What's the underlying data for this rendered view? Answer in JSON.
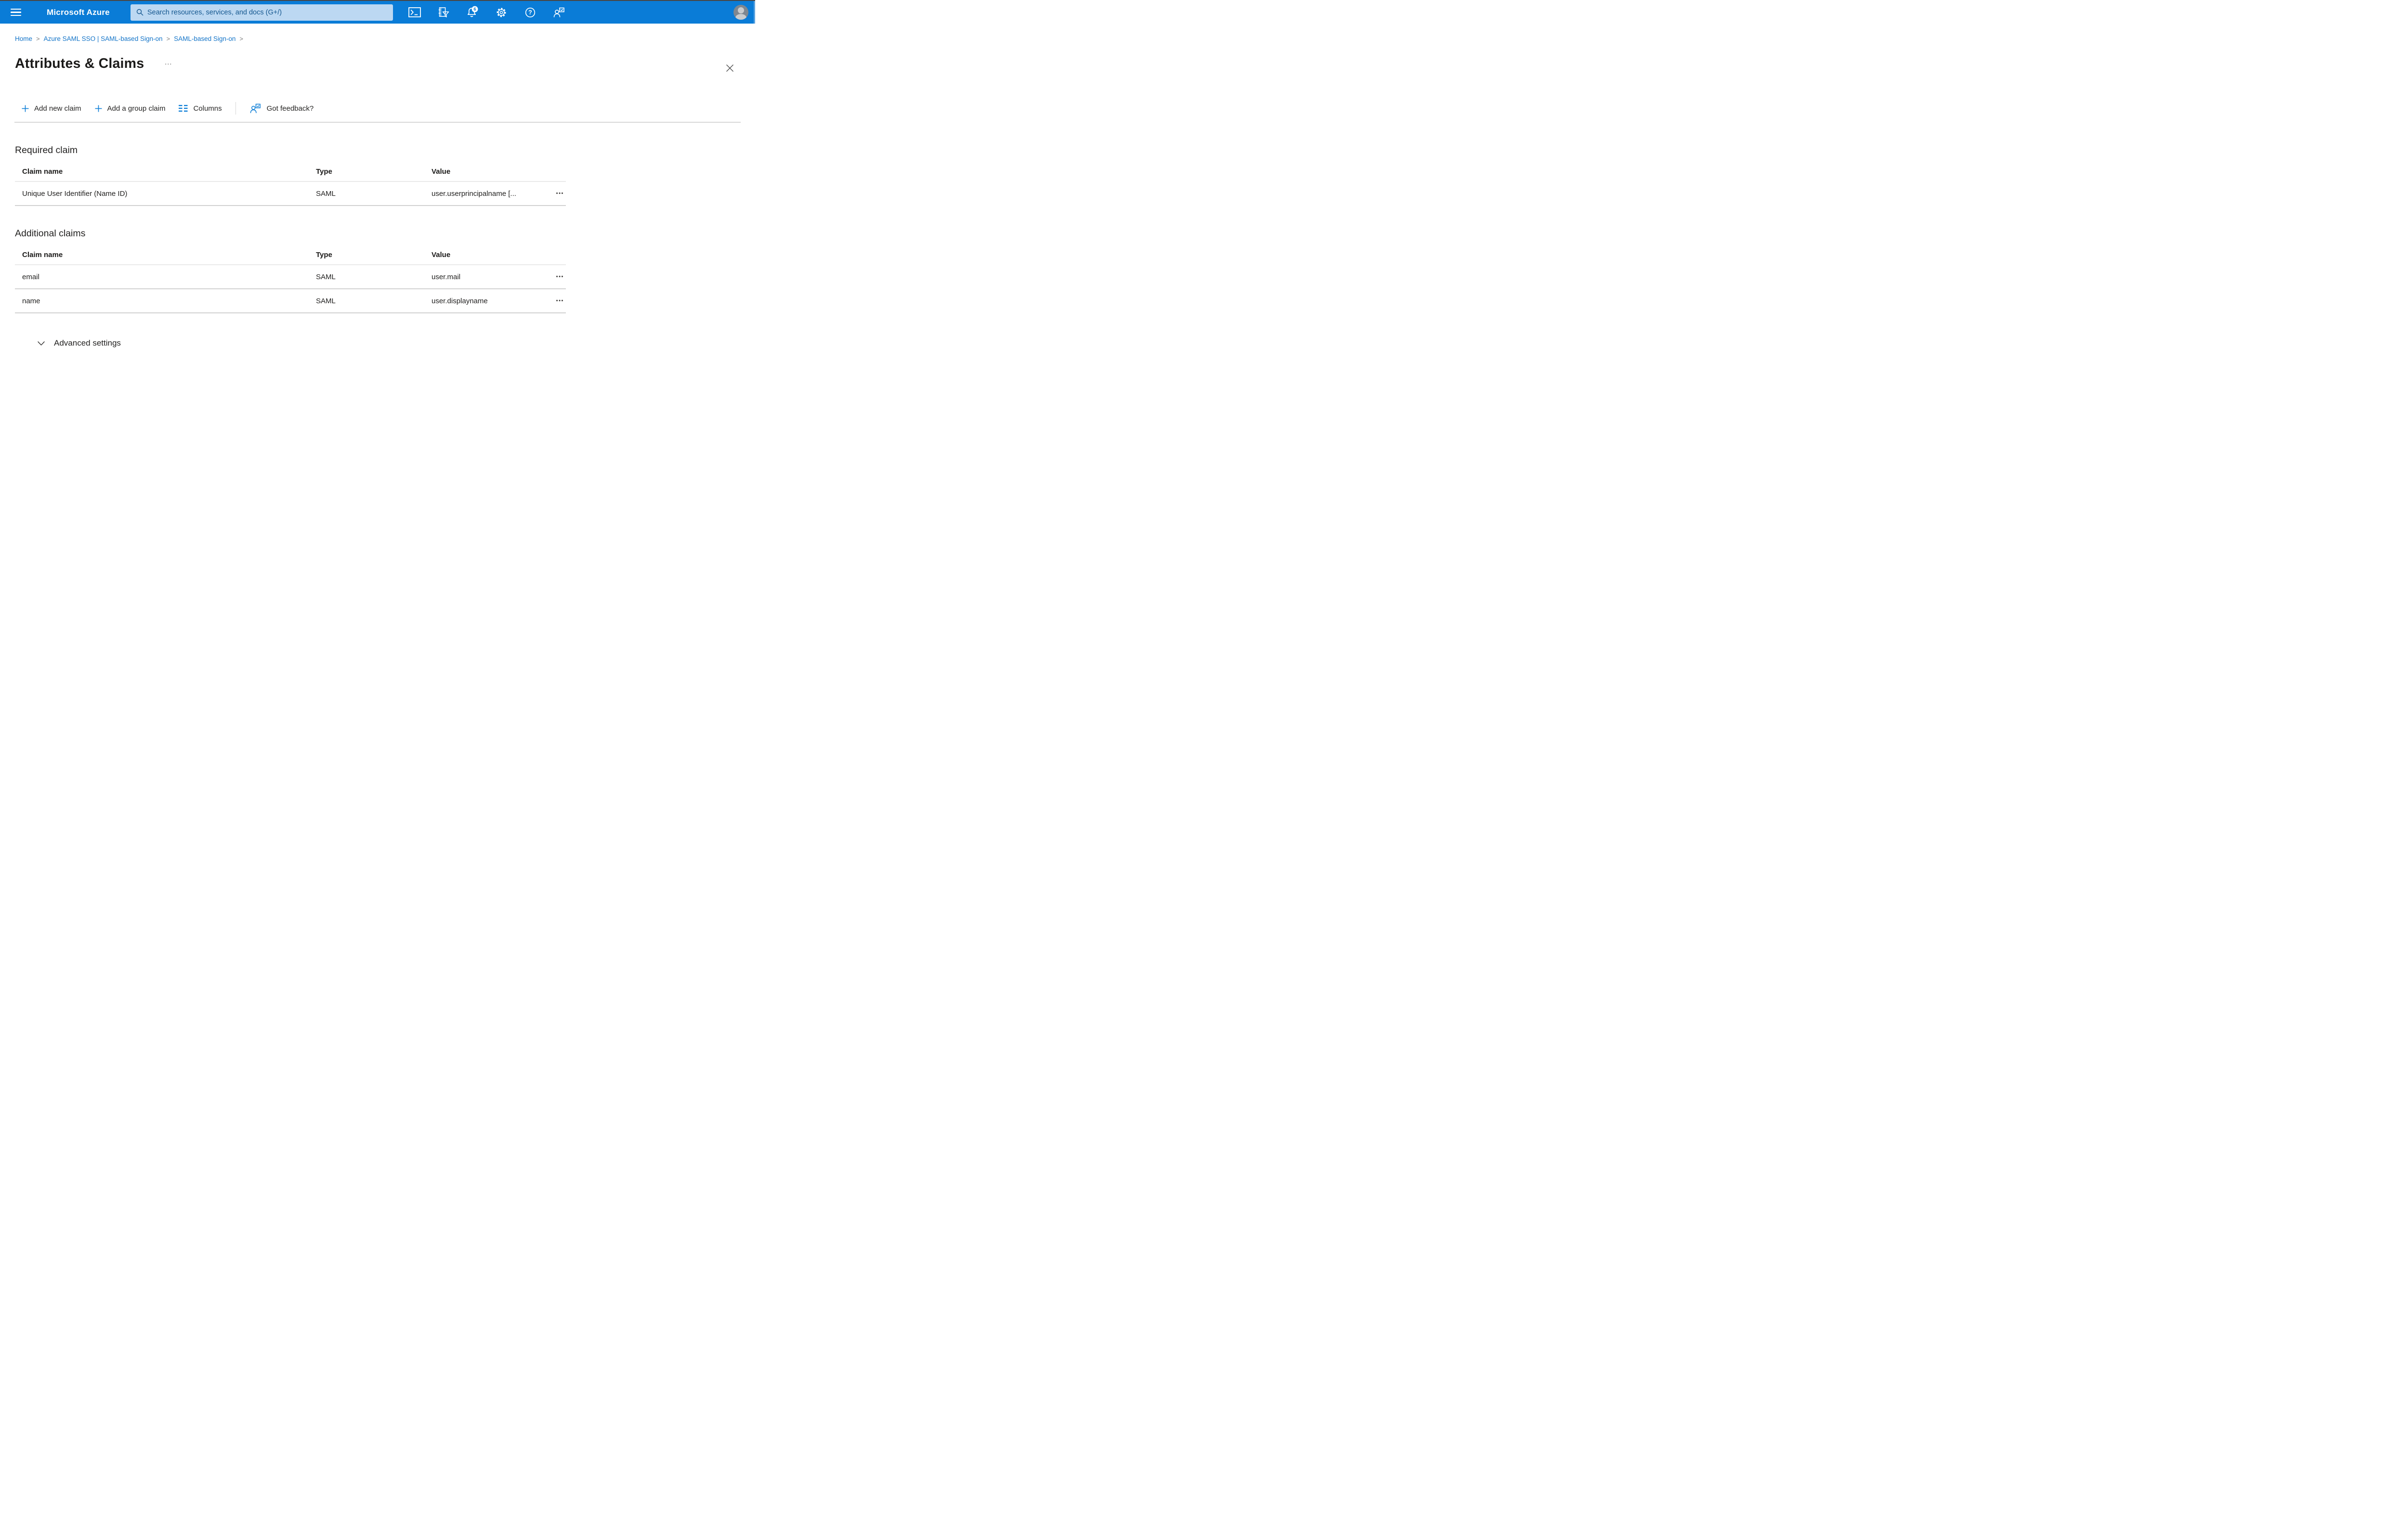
{
  "colors": {
    "topbar_blue": "#0a7cd7",
    "search_field_bg": "#bcd8f2",
    "search_field_text": "#14578f",
    "link_blue": "#1374c8",
    "toolbar_icon_blue": "#0f7fd7",
    "text_primary": "#201f1e",
    "divider_gray": "#d8d8d8"
  },
  "topbar": {
    "brand": "Microsoft Azure",
    "search_placeholder": "Search resources, services, and docs (G+/)",
    "notification_badge": "6",
    "help_glyph": "?"
  },
  "breadcrumb": {
    "separator": ">",
    "items": [
      {
        "label": "Home"
      },
      {
        "label": "Azure SAML SSO | SAML-based Sign-on"
      },
      {
        "label": "SAML-based Sign-on"
      }
    ]
  },
  "page": {
    "title": "Attributes & Claims",
    "overflow_glyph": "…"
  },
  "toolbar": {
    "items": [
      {
        "label": "Add new claim"
      },
      {
        "label": "Add a group claim"
      },
      {
        "label": "Columns"
      },
      {
        "label": "Got feedback?"
      }
    ]
  },
  "tables": {
    "row_menu_glyph": "•••",
    "required": {
      "heading": "Required claim",
      "columns": [
        "Claim name",
        "Type",
        "Value"
      ],
      "rows": [
        {
          "claim_name": "Unique User Identifier (Name ID)",
          "type": "SAML",
          "value": "user.userprincipalname [..."
        }
      ]
    },
    "additional": {
      "heading": "Additional claims",
      "columns": [
        "Claim name",
        "Type",
        "Value"
      ],
      "rows": [
        {
          "claim_name": "email",
          "type": "SAML",
          "value": "user.mail"
        },
        {
          "claim_name": "name",
          "type": "SAML",
          "value": "user.displayname"
        }
      ]
    }
  },
  "advanced": {
    "label": "Advanced settings"
  }
}
